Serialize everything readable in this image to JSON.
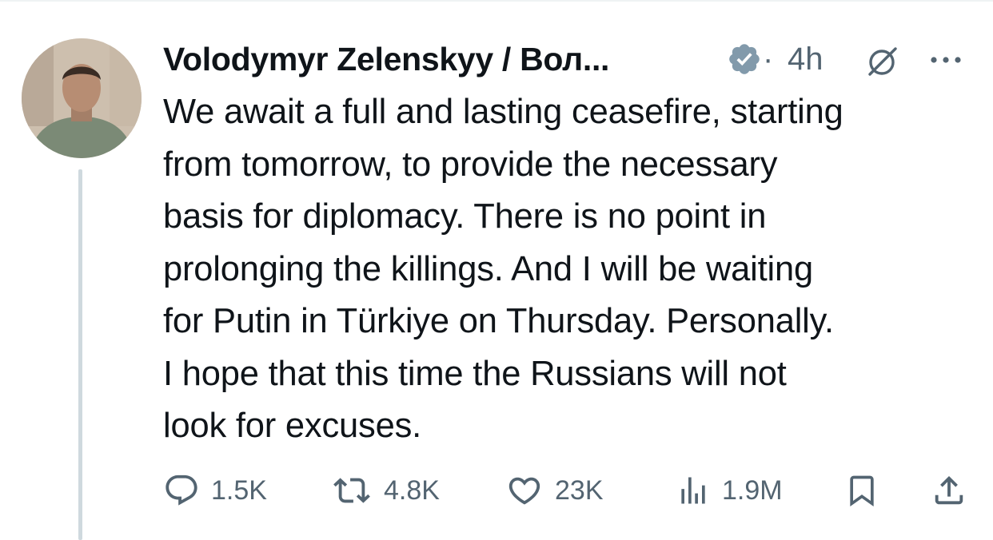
{
  "post": {
    "display_name": "Volodymyr Zelenskyy / Вол...",
    "separator": "·",
    "timestamp": "4h",
    "lines": [
      "We await a full and lasting ceasefire, starting",
      "from tomorrow, to provide the necessary",
      "basis for diplomacy. There is no point in",
      "prolonging the killings. And I will be waiting",
      "for Putin in Türkiye on Thursday. Personally.",
      "I hope that this time the Russians will not",
      "look for excuses."
    ],
    "icons": {
      "avatar": "avatar-photo",
      "verified": "verified-badge-icon",
      "grok": "grok-icon",
      "more": "more-icon"
    }
  },
  "actions": {
    "reply": {
      "icon": "reply-icon",
      "count": "1.5K"
    },
    "repost": {
      "icon": "repost-icon",
      "count": "4.8K"
    },
    "like": {
      "icon": "like-icon",
      "count": "23K"
    },
    "views": {
      "icon": "views-icon",
      "count": "1.9M"
    },
    "bookmark": {
      "icon": "bookmark-icon"
    },
    "share": {
      "icon": "share-icon"
    }
  },
  "colors": {
    "text": "#0f1419",
    "secondary": "#536471",
    "verified_badge": "#829aab",
    "thread_line": "#cfd9de"
  }
}
